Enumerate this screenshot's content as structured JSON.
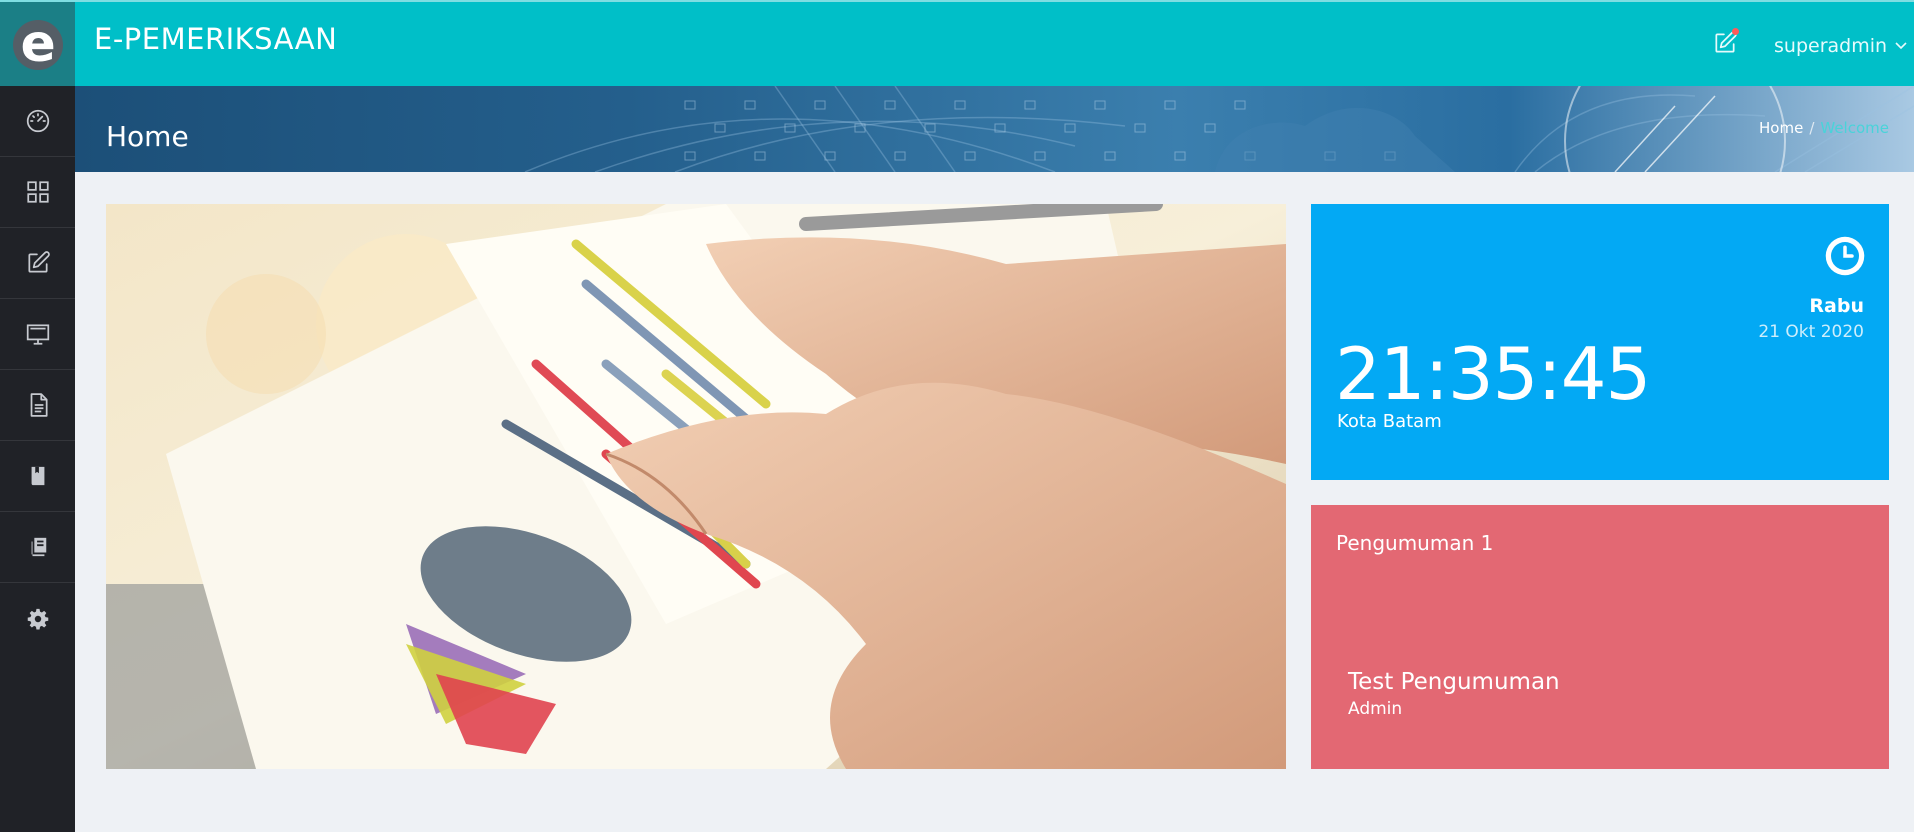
{
  "app": {
    "title": "E-PEMERIKSAAN",
    "logo_letter": "e"
  },
  "topbar": {
    "user": "superadmin",
    "edit_icon": "edit-icon",
    "notification_dot": true
  },
  "sidebar": {
    "items": [
      {
        "icon": "dashboard-gauge-icon"
      },
      {
        "icon": "grid-icon"
      },
      {
        "icon": "edit-icon"
      },
      {
        "icon": "monitor-icon"
      },
      {
        "icon": "document-icon"
      },
      {
        "icon": "book-icon"
      },
      {
        "icon": "books-icon"
      },
      {
        "icon": "gear-icon"
      }
    ]
  },
  "header": {
    "page_title": "Home",
    "breadcrumb": {
      "home": "Home",
      "separator": "/",
      "current": "Welcome"
    }
  },
  "clock_card": {
    "day": "Rabu",
    "date": "21 Okt 2020",
    "time": "21:35:45",
    "city": "Kota Batam",
    "icon": "clock-icon"
  },
  "announcement_card": {
    "title": "Pengumuman 1",
    "item_title": "Test Pengumuman",
    "item_author": "Admin"
  },
  "colors": {
    "topbar": "#00bfc8",
    "sidebar": "#202227",
    "clock_card": "#03a9f4",
    "announcement_card": "#e36873",
    "breadcrumb_active": "#49d3d9"
  }
}
